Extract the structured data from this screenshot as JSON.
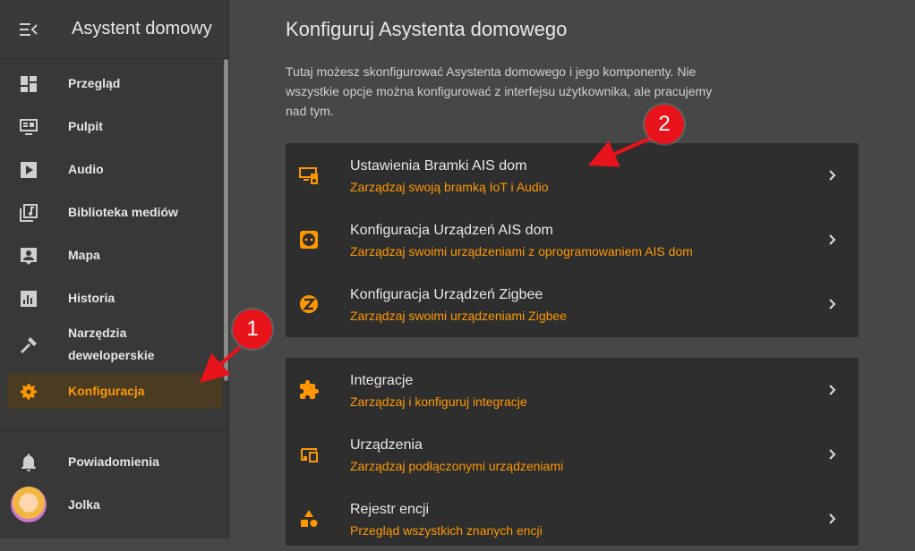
{
  "sidebar": {
    "app_title": "Asystent domowy",
    "items": [
      {
        "label": "Przegląd",
        "icon": "dashboard-icon"
      },
      {
        "label": "Pulpit",
        "icon": "monitor-icon"
      },
      {
        "label": "Audio",
        "icon": "play-icon"
      },
      {
        "label": "Biblioteka mediów",
        "icon": "music-library-icon"
      },
      {
        "label": "Mapa",
        "icon": "person-box-icon"
      },
      {
        "label": "Historia",
        "icon": "chart-bar-icon"
      },
      {
        "label": "Narzędzia\ndeweloperskie",
        "label_line1": "Narzędzia",
        "label_line2": "deweloperskie",
        "icon": "hammer-icon"
      },
      {
        "label": "Konfiguracja",
        "icon": "gear-icon",
        "active": true
      }
    ],
    "bottom_items": [
      {
        "label": "Powiadomienia",
        "icon": "bell-icon"
      },
      {
        "label": "Jolka",
        "icon": "avatar"
      }
    ]
  },
  "main": {
    "title": "Konfiguruj Asystenta domowego",
    "description": "Tutaj możesz skonfigurować Asystenta domowego i jego komponenty. Nie wszystkie opcje można konfigurować z interfejsu użytkownika, ale pracujemy nad tym.",
    "card1": [
      {
        "title": "Ustawienia Bramki AIS dom",
        "subtitle": "Zarządzaj swoją bramką IoT i Audio",
        "icon": "gateway-icon"
      },
      {
        "title": "Konfiguracja Urządzeń AIS dom",
        "subtitle": "Zarządzaj swoimi urządzeniami z oprogramowaniem AIS dom",
        "icon": "socket-icon"
      },
      {
        "title": "Konfiguracja Urządzeń Zigbee",
        "subtitle": "Zarządzaj swoimi urządzeniami Zigbee",
        "icon": "zigbee-icon"
      }
    ],
    "card2": [
      {
        "title": "Integracje",
        "subtitle": "Zarządzaj i konfiguruj integracje",
        "icon": "puzzle-icon"
      },
      {
        "title": "Urządzenia",
        "subtitle": "Zarządzaj podłączonymi urządzeniami",
        "icon": "devices-icon"
      },
      {
        "title": "Rejestr encji",
        "subtitle": "Przegląd wszystkich znanych encji",
        "icon": "shapes-icon"
      }
    ]
  },
  "annotations": {
    "badge1": "1",
    "badge2": "2"
  },
  "colors": {
    "accent": "#ff9800",
    "sidebar_bg": "#383838",
    "main_bg": "#474747",
    "card_bg": "#2e2e2e",
    "badge": "#e8131b"
  }
}
